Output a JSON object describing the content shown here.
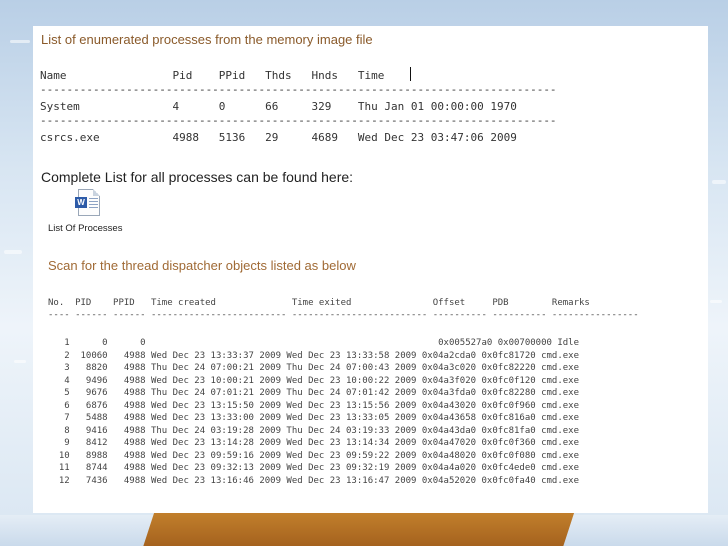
{
  "process_list": {
    "title": "List of enumerated processes from the memory image file",
    "header": "Name                Pid    PPid   Thds   Hnds   Time",
    "separator": "------------------------------------------------------------------------------",
    "rows": [
      "System              4      0      66     329    Thu Jan 01 00:00:00 1970",
      "csrcs.exe           4988   5136   29     4689   Wed Dec 23 03:47:06 2009"
    ]
  },
  "complete_list": {
    "text": "Complete List for all processes can be found here:",
    "attachment_label": "List Of Processes",
    "attachment_icon": "word-document-icon"
  },
  "thread_scan": {
    "title": "Scan for the thread dispatcher objects listed as below",
    "header": "No.  PID    PPID   Time created              Time exited               Offset     PDB        Remarks",
    "separator": "---- ------ ------ ------------------------- ------------------------- ---------- ---------- ----------------",
    "rows": [
      "   1      0      0                                                      0x005527a0 0x00700000 Idle",
      "   2  10060   4988 Wed Dec 23 13:33:37 2009 Wed Dec 23 13:33:58 2009 0x04a2cda0 0x0fc81720 cmd.exe",
      "   3   8820   4988 Thu Dec 24 07:00:21 2009 Thu Dec 24 07:00:43 2009 0x04a3c020 0x0fc82220 cmd.exe",
      "   4   9496   4988 Wed Dec 23 10:00:21 2009 Wed Dec 23 10:00:22 2009 0x04a3f020 0x0fc0f120 cmd.exe",
      "   5   9676   4988 Thu Dec 24 07:01:21 2009 Thu Dec 24 07:01:42 2009 0x04a3fda0 0x0fc82280 cmd.exe",
      "   6   6876   4988 Wed Dec 23 13:15:50 2009 Wed Dec 23 13:15:56 2009 0x04a43020 0x0fc0f960 cmd.exe",
      "   7   5488   4988 Wed Dec 23 13:33:00 2009 Wed Dec 23 13:33:05 2009 0x04a43658 0x0fc816a0 cmd.exe",
      "   8   9416   4988 Thu Dec 24 03:19:28 2009 Thu Dec 24 03:19:33 2009 0x04a43da0 0x0fc81fa0 cmd.exe",
      "   9   8412   4988 Wed Dec 23 13:14:28 2009 Wed Dec 23 13:14:34 2009 0x04a47020 0x0fc0f360 cmd.exe",
      "  10   8988   4988 Wed Dec 23 09:59:16 2009 Wed Dec 23 09:59:22 2009 0x04a48020 0x0fc0f080 cmd.exe",
      "  11   8744   4988 Wed Dec 23 09:32:13 2009 Wed Dec 23 09:32:19 2009 0x04a4a020 0x0fc4ede0 cmd.exe",
      "  12   7436   4988 Wed Dec 23 13:16:46 2009 Wed Dec 23 13:16:47 2009 0x04a52020 0x0fc0fa40 cmd.exe"
    ]
  }
}
